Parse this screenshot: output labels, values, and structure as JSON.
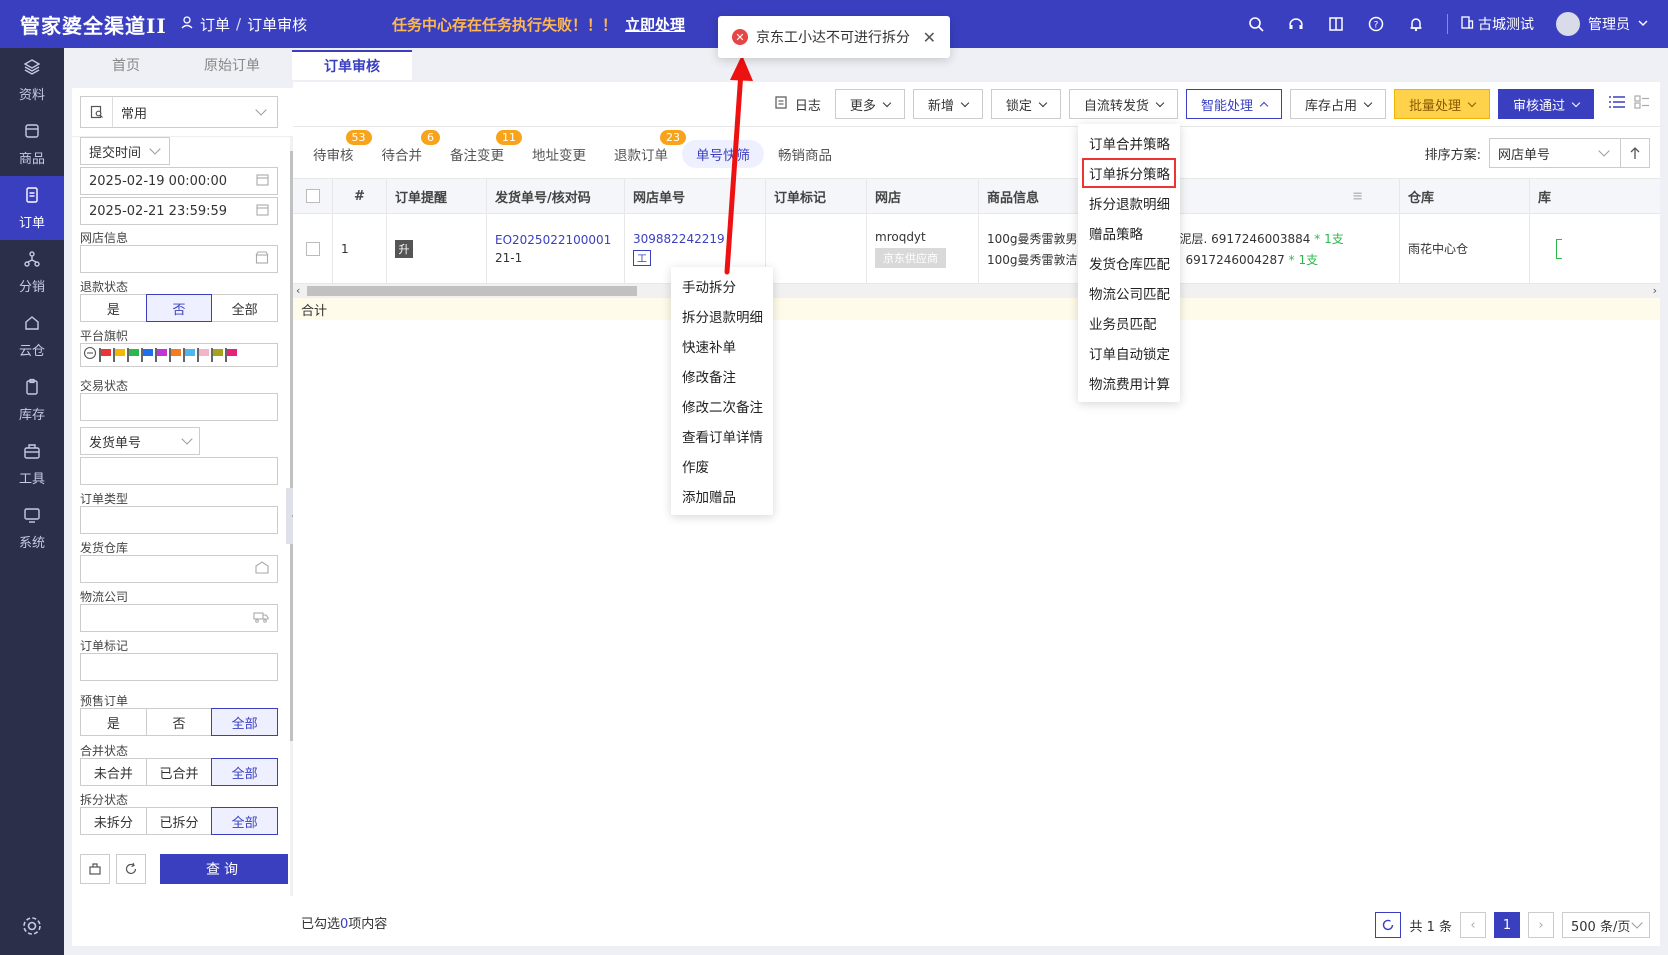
{
  "app": {
    "brand": "管家婆全渠道II"
  },
  "breadcrumb": {
    "section": "订单",
    "page": "订单审核"
  },
  "alert": {
    "message": "任务中心存在任务执行失败！！！",
    "action": "立即处理"
  },
  "toast": {
    "message": "京东工小达不可进行拆分"
  },
  "topbar": {
    "company": "古城测试",
    "user": "管理员"
  },
  "nav": [
    {
      "label": "资料"
    },
    {
      "label": "商品"
    },
    {
      "label": "订单"
    },
    {
      "label": "分销"
    },
    {
      "label": "云仓"
    },
    {
      "label": "库存"
    },
    {
      "label": "工具"
    },
    {
      "label": "系统"
    }
  ],
  "page_tabs": [
    {
      "label": "首页"
    },
    {
      "label": "原始订单"
    },
    {
      "label": "订单审核"
    }
  ],
  "filter": {
    "scheme": "常用",
    "time_type": "提交时间",
    "start_time": "2025-02-19 00:00:00",
    "end_time": "2025-02-21 23:59:59",
    "shop_label": "网店信息",
    "refund_label": "退款状态",
    "refund_options": [
      "是",
      "否",
      "全部"
    ],
    "flag_label": "平台旗帜",
    "trade_label": "交易状态",
    "number_type": "发货单号",
    "order_type_label": "订单类型",
    "warehouse_label": "发货仓库",
    "logistics_label": "物流公司",
    "mark_label": "订单标记",
    "presale_label": "预售订单",
    "presale_options": [
      "是",
      "否",
      "全部"
    ],
    "merge_label": "合并状态",
    "merge_options": [
      "未合并",
      "已合并",
      "全部"
    ],
    "split_label": "拆分状态",
    "split_options": [
      "未拆分",
      "已拆分",
      "全部"
    ],
    "query": "查询"
  },
  "toolbar": {
    "log": "日志",
    "more": "更多",
    "add": "新增",
    "lock": "锁定",
    "auto_ship": "自流转发货",
    "smart": "智能处理",
    "stock": "库存占用",
    "batch": "批量处理",
    "approve": "审核通过"
  },
  "status_tabs": [
    {
      "label": "待审核",
      "badge": "53"
    },
    {
      "label": "待合并",
      "badge": "6"
    },
    {
      "label": "备注变更",
      "badge": "11"
    },
    {
      "label": "地址变更",
      "badge": ""
    },
    {
      "label": "退款订单",
      "badge": "23"
    },
    {
      "label": "单号快筛",
      "badge": ""
    },
    {
      "label": "畅销商品",
      "badge": ""
    }
  ],
  "sort": {
    "label": "排序方案:",
    "value": "网店单号"
  },
  "table": {
    "headers": [
      "#",
      "订单提醒",
      "发货单号/核对码",
      "网店单号",
      "订单标记",
      "网店",
      "商品信息",
      "仓库",
      "库"
    ],
    "row": {
      "index": "1",
      "reminder": "升",
      "ship_no": "EO2025022100001",
      "check_code": "21-1",
      "shop_order": "309882242219",
      "shop_tag": "工",
      "shop": "mroqdyt",
      "supplier": "京东供应商",
      "goods1": "100g曼秀雷敦男士",
      "goods2": "100g曼秀雷敦洁面",
      "barcode1": "泥层. 6917246003884",
      "qty1": "* 1支",
      "barcode2": "6917246004287",
      "qty2": "* 1支",
      "warehouse": "雨花中心仓"
    },
    "total": "合计"
  },
  "context_menu": [
    "手动拆分",
    "拆分退款明细",
    "快速补单",
    "修改备注",
    "修改二次备注",
    "查看订单详情",
    "作废",
    "添加赠品"
  ],
  "smart_menu": [
    "订单合并策略",
    "订单拆分策略",
    "拆分退款明细",
    "赠品策略",
    "发货仓库匹配",
    "物流公司匹配",
    "业务员匹配",
    "订单自动锁定",
    "物流费用计算"
  ],
  "footer": {
    "selected_prefix": "已勾选",
    "selected_count": "0",
    "selected_suffix": "项内容"
  },
  "pager": {
    "total": "共 1 条",
    "page": "1",
    "size": "500 条/页"
  },
  "colors": {
    "primary": "#3a3fc0",
    "alert": "#ffb84d",
    "badge": "#f7a31c",
    "highlight": "#e33"
  }
}
